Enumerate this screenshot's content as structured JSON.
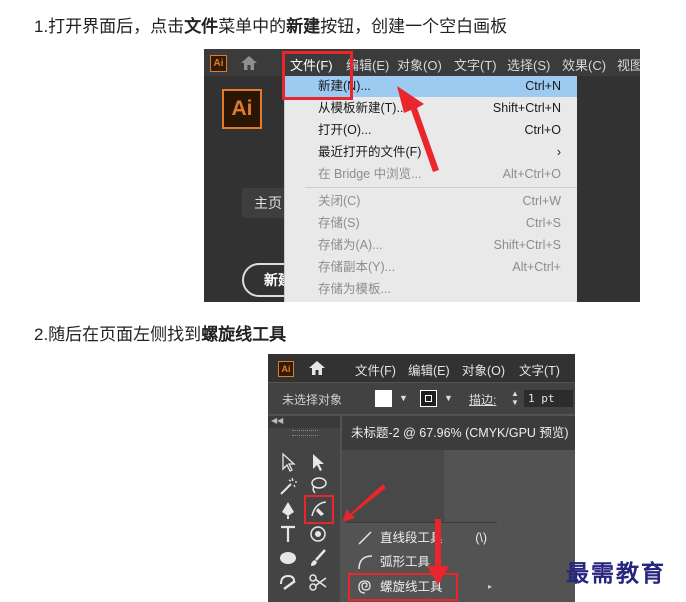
{
  "step1": {
    "prefix": "1.打开界面后，点击",
    "bold1": "文件",
    "mid": "菜单中的",
    "bold2": "新建",
    "suffix": "按钮，创建一个空白画板"
  },
  "step2": {
    "prefix": "2.随后在页面左侧找到",
    "bold": "螺旋线工具"
  },
  "shot1": {
    "ai_logo": "Ai",
    "menus": [
      "文件(F)",
      "编辑(E)",
      "对象(O)",
      "文字(T)",
      "选择(S)",
      "效果(C)",
      "视图"
    ],
    "home_tab": "主页",
    "new_button": "新建",
    "file_menu": [
      {
        "label": "新建(N)...",
        "shortcut": "Ctrl+N"
      },
      {
        "label": "从模板新建(T)...",
        "shortcut": "Shift+Ctrl+N"
      },
      {
        "label": "打开(O)...",
        "shortcut": "Ctrl+O"
      },
      {
        "label": "最近打开的文件(F)",
        "shortcut": "›"
      },
      {
        "label": "在 Bridge 中浏览...",
        "shortcut": "Alt+Ctrl+O"
      },
      {
        "label": "关闭(C)",
        "shortcut": "Ctrl+W"
      },
      {
        "label": "存储(S)",
        "shortcut": "Ctrl+S"
      },
      {
        "label": "存储为(A)...",
        "shortcut": "Shift+Ctrl+S"
      },
      {
        "label": "存储副本(Y)...",
        "shortcut": "Alt+Ctrl+"
      },
      {
        "label": "存储为模板...",
        "shortcut": ""
      }
    ]
  },
  "shot2": {
    "ai_logo": "Ai",
    "menus": [
      "文件(F)",
      "编辑(E)",
      "对象(O)",
      "文字(T)"
    ],
    "no_selection": "未选择对象",
    "stroke_label": "描边:",
    "stroke_value": "1 pt",
    "doc_tab": "未标题-2 @ 67.96% (CMYK/GPU 预览)",
    "flyout": [
      {
        "label": "直线段工具",
        "shortcut": "(\\)"
      },
      {
        "label": "弧形工具",
        "shortcut": ""
      },
      {
        "label": "螺旋线工具",
        "shortcut": ""
      }
    ]
  },
  "watermark": "最需教育",
  "colors": {
    "highlight_red": "#e8262b",
    "menu_highlight": "#9ccaf0",
    "ai_orange": "#e07b2e",
    "watermark_blue": "#27267e"
  }
}
